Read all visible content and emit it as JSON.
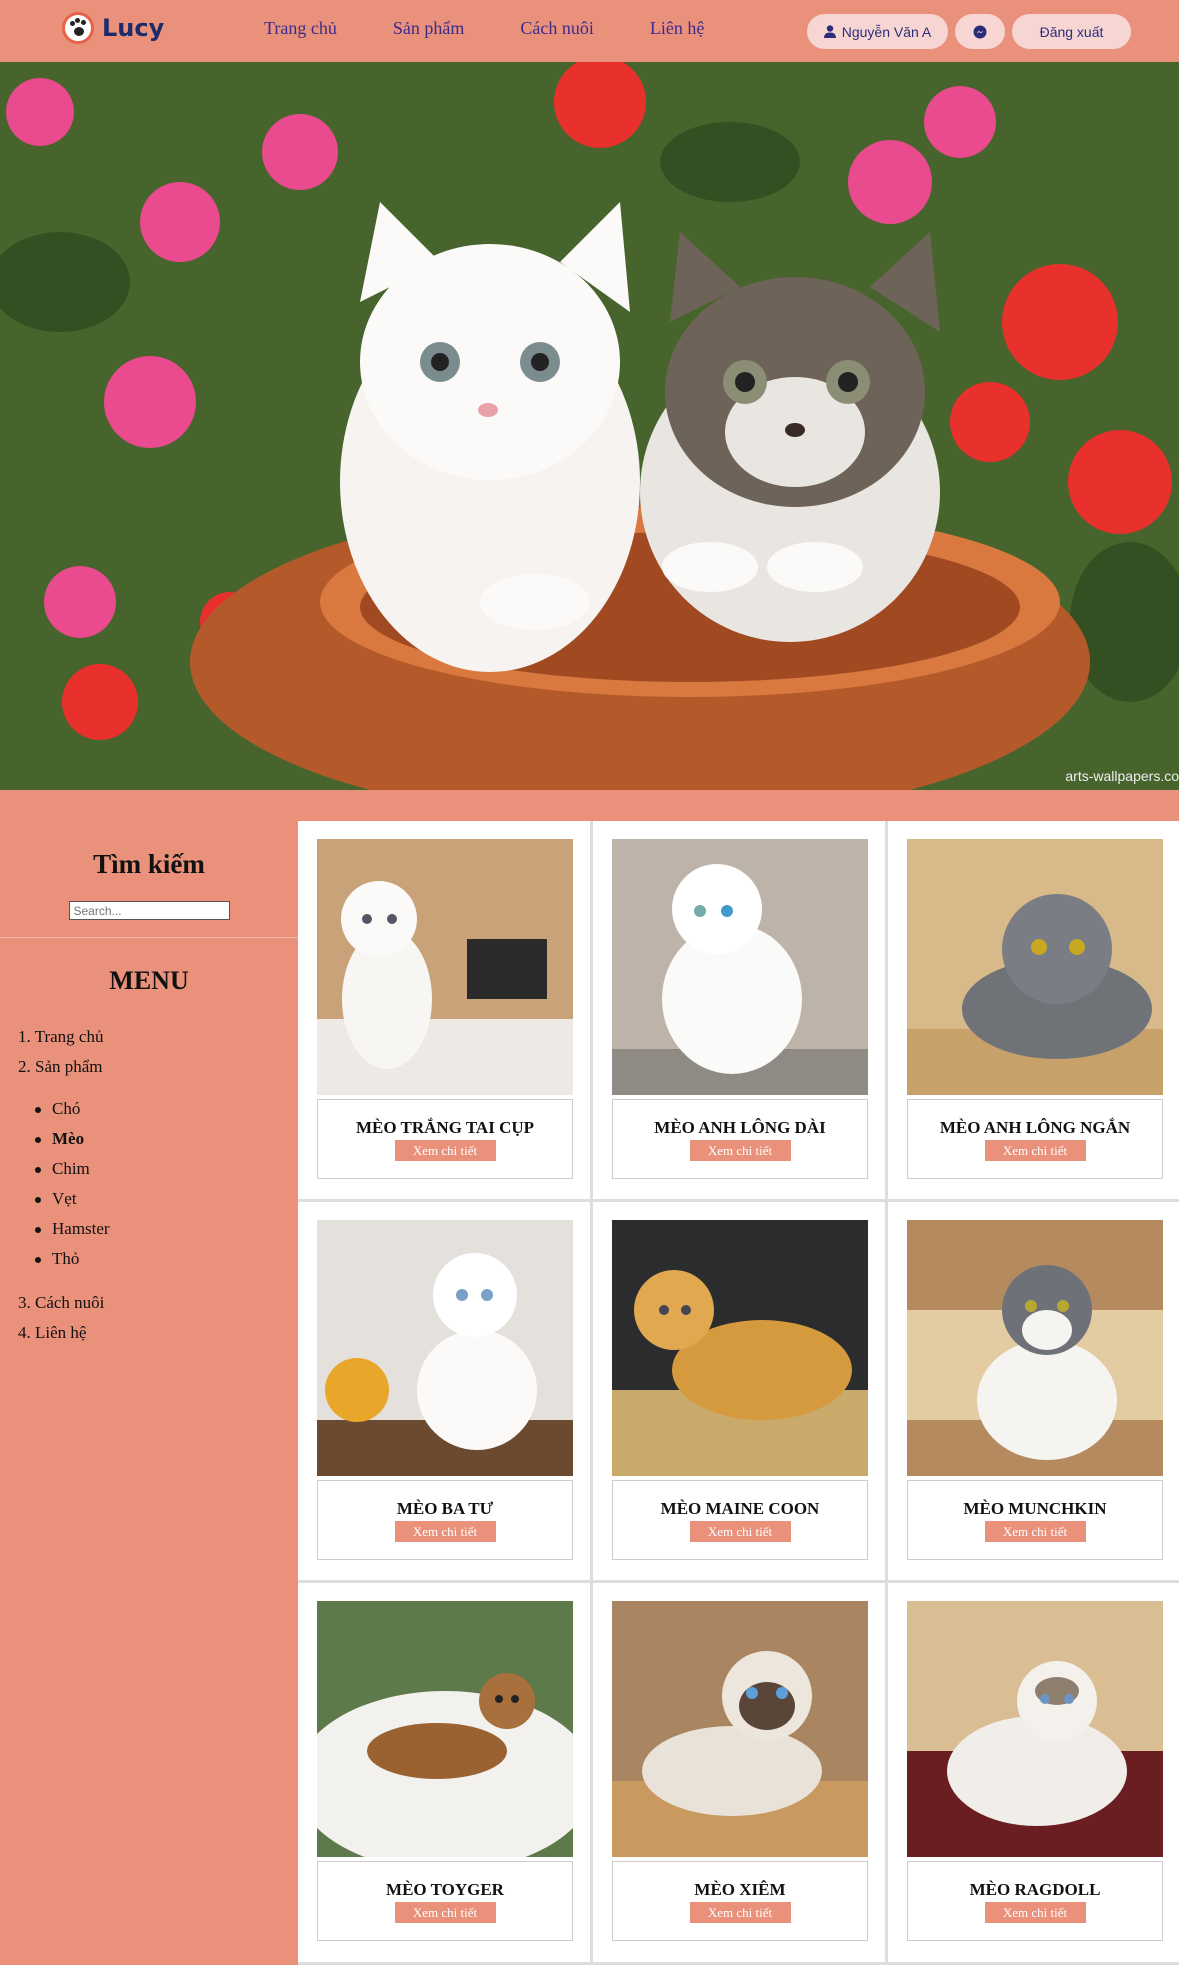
{
  "brand": {
    "name": "Lucy"
  },
  "nav": {
    "items": [
      "Trang chủ",
      "Sản phẩm",
      "Cách nuôi",
      "Liên hệ"
    ]
  },
  "account": {
    "user_label": "Nguyễn Văn A",
    "logout_label": "Đăng xuất"
  },
  "hero": {
    "credit": "arts-wallpapers.co"
  },
  "sidebar": {
    "search_title": "Tìm kiếm",
    "search_placeholder": "Search...",
    "menu_title": "MENU",
    "menu_items": [
      "1. Trang chủ",
      "2. Sản phẩm",
      "3. Cách nuôi",
      "4. Liên hệ"
    ],
    "sub_items": [
      "Chó",
      "Mèo",
      "Chim",
      "Vẹt",
      "Hamster",
      "Thỏ"
    ],
    "active_sub": "Mèo"
  },
  "products": [
    {
      "name": "MÈO TRẮNG TAI CỤP",
      "button": "Xem chi tiết"
    },
    {
      "name": "MÈO ANH LÔNG DÀI",
      "button": "Xem chi tiết"
    },
    {
      "name": "MÈO ANH LÔNG NGẮN",
      "button": "Xem chi tiết"
    },
    {
      "name": "MÈO BA TƯ",
      "button": "Xem chi tiết"
    },
    {
      "name": "MÈO MAINE COON",
      "button": "Xem chi tiết"
    },
    {
      "name": "MÈO MUNCHKIN",
      "button": "Xem chi tiết"
    },
    {
      "name": "MÈO TOYGER",
      "button": "Xem chi tiết"
    },
    {
      "name": "MÈO XIÊM",
      "button": "Xem chi tiết"
    },
    {
      "name": "MÈO RAGDOLL",
      "button": "Xem chi tiết"
    }
  ],
  "colors": {
    "accent": "#E9917A",
    "nav_text": "#3B2B8C",
    "pill": "#F7D5D3",
    "brand_text": "#1D2B6B"
  }
}
